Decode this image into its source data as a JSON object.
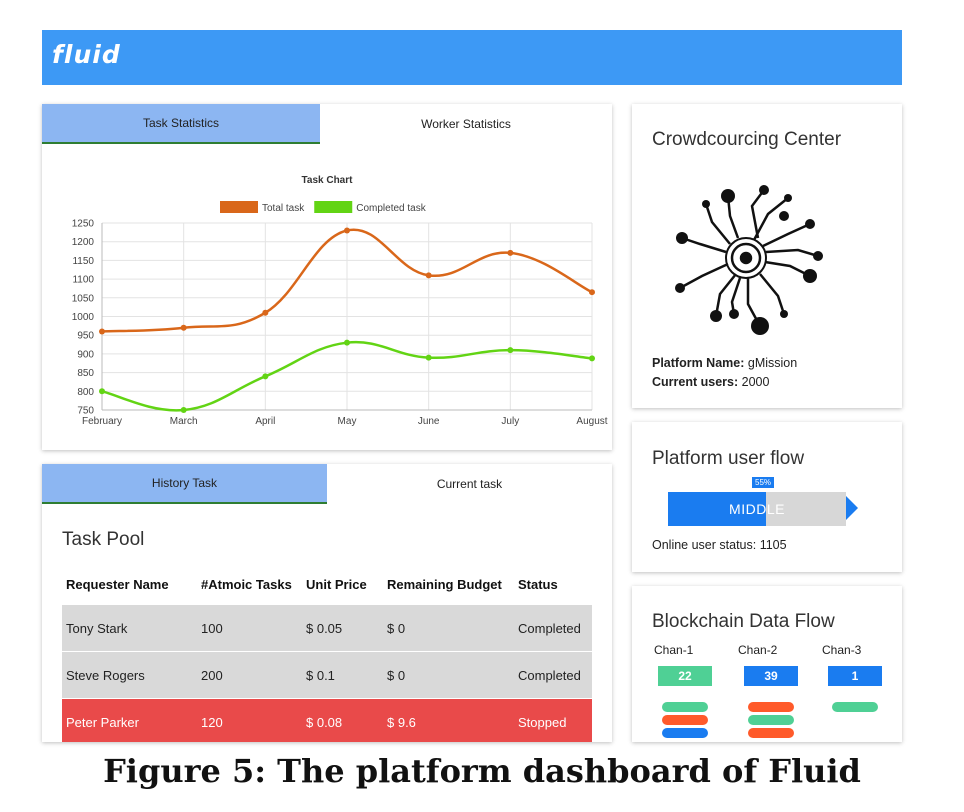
{
  "header": {
    "brand": "fluid"
  },
  "stats_tabs": [
    {
      "label": "Task Statistics",
      "active": true
    },
    {
      "label": "Worker Statistics",
      "active": false
    }
  ],
  "chart_data": {
    "type": "line",
    "title": "Task Chart",
    "categories": [
      "February",
      "March",
      "April",
      "May",
      "June",
      "July",
      "August"
    ],
    "series": [
      {
        "name": "Total task",
        "color": "#d9671a",
        "values": [
          960,
          970,
          1010,
          1230,
          1110,
          1170,
          1065
        ]
      },
      {
        "name": "Completed task",
        "color": "#62d414",
        "values": [
          800,
          750,
          840,
          930,
          890,
          910,
          888
        ]
      }
    ],
    "yticks": [
      750,
      800,
      850,
      900,
      950,
      1000,
      1050,
      1100,
      1150,
      1200,
      1250
    ],
    "ylim": [
      750,
      1250
    ],
    "grid": true,
    "legend": "top"
  },
  "task_tabs": [
    {
      "label": "History Task",
      "active": true
    },
    {
      "label": "Current task",
      "active": false
    }
  ],
  "task_pool": {
    "title": "Task Pool",
    "columns": [
      "Requester Name",
      "#Atmoic Tasks",
      "Unit Price",
      "Remaining Budget",
      "Status"
    ],
    "rows": [
      [
        "Tony Stark",
        "100",
        "$ 0.05",
        "$ 0",
        "Completed"
      ],
      [
        "Steve Rogers",
        "200",
        "$ 0.1",
        "$ 0",
        "Completed"
      ],
      [
        "Peter Parker",
        "120",
        "$ 0.08",
        "$ 9.6",
        "Stopped"
      ]
    ],
    "row_colors": [
      "gray",
      "gray",
      "red"
    ]
  },
  "crowd_center": {
    "title": "Crowdcourcing Center",
    "platform_label": "Platform Name:",
    "platform_value": "gMission",
    "users_label": "Current users:",
    "users_value": "2000"
  },
  "user_flow": {
    "title": "Platform user flow",
    "percent": 55,
    "percent_label": "55%",
    "level": "MIDDLE",
    "status_text": "Online user status: 1105"
  },
  "blockchain": {
    "title": "Blockchain Data Flow",
    "channels": [
      {
        "name": "Chan-1",
        "count": "22",
        "color": "#4fd095"
      },
      {
        "name": "Chan-2",
        "count": "39",
        "color": "#1a7cf0"
      },
      {
        "name": "Chan-3",
        "count": "1",
        "color": "#1a7cf0"
      }
    ],
    "pill_colors": {
      "green": "#4fd095",
      "orange": "#ff5a2a",
      "blue": "#1a7cf0"
    }
  },
  "caption": "Figure 5: The platform dashboard of Fluid"
}
